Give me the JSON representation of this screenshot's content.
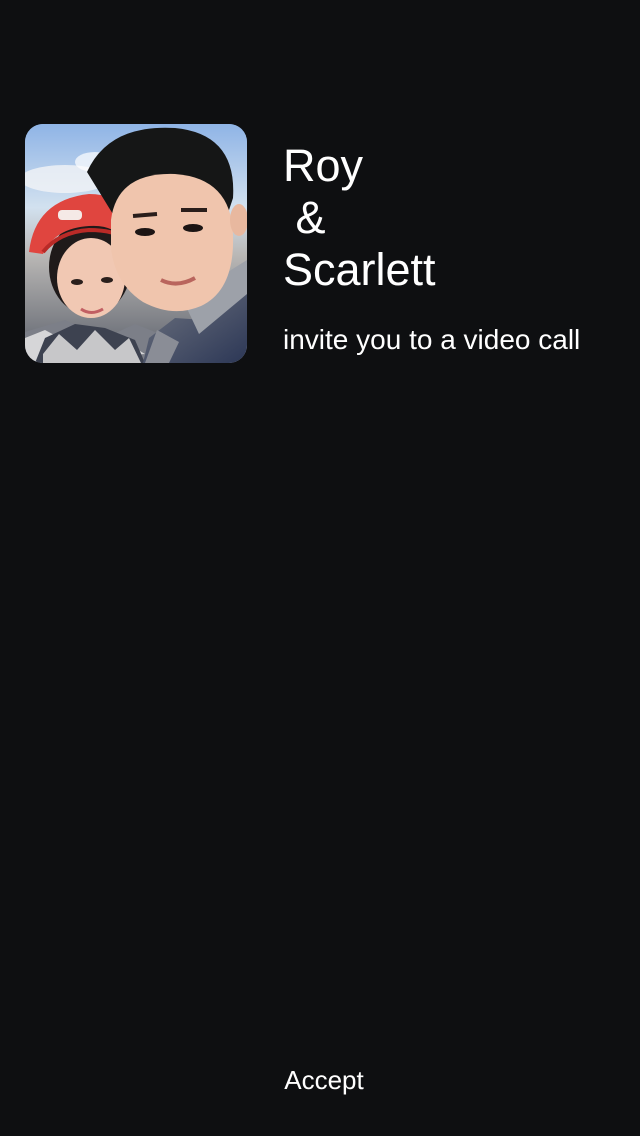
{
  "caller": {
    "name_line_1": "Roy",
    "name_line_2": " &",
    "name_line_3": "Scarlett",
    "avatar": "couple-photo"
  },
  "message": "invite you to a video call",
  "actions": {
    "accept_label": "Accept"
  }
}
